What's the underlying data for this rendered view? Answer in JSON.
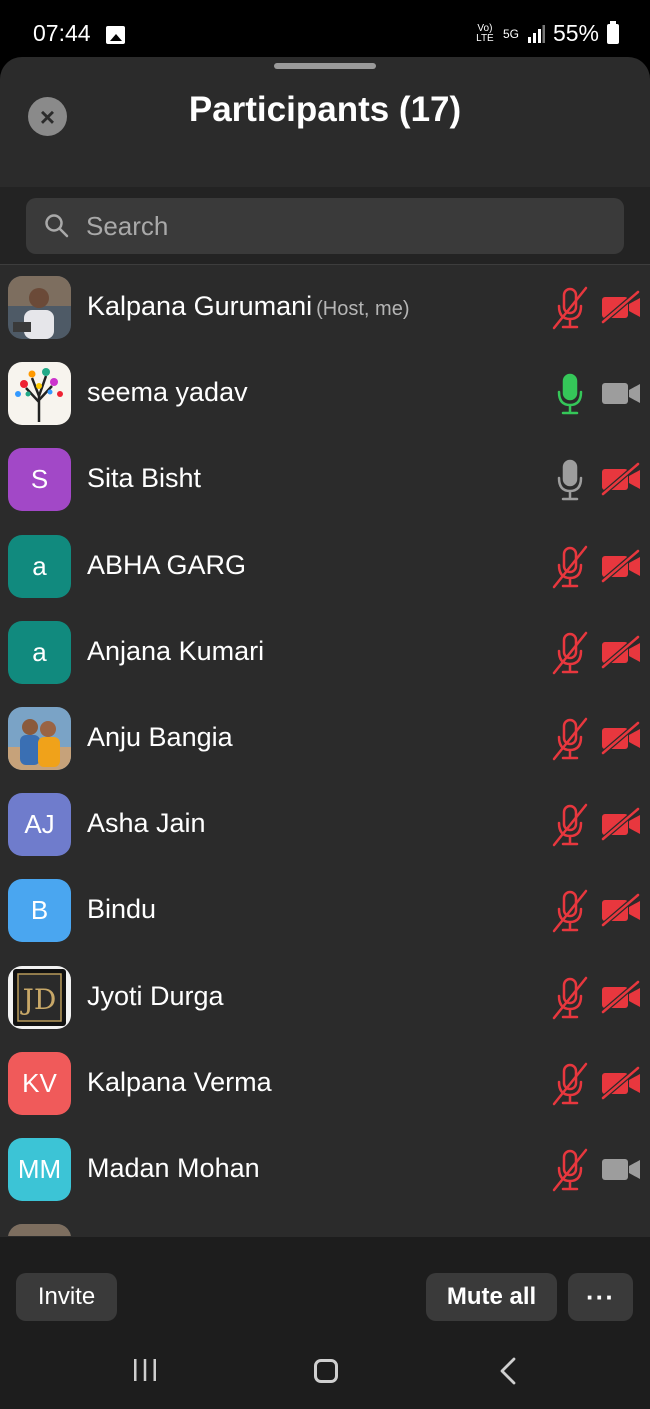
{
  "status_bar": {
    "time": "07:44",
    "network": "5G",
    "volte": "Vo) LTE",
    "battery": "55%"
  },
  "header": {
    "title": "Participants (17)",
    "close_icon": "close-icon"
  },
  "search": {
    "placeholder": "Search",
    "value": ""
  },
  "colors": {
    "muted_red": "#e8373e",
    "active_green": "#35c759",
    "neutral_gray": "#9d9d9d",
    "panel_bg": "#2b2b2b"
  },
  "participants": [
    {
      "name": "Kalpana Gurumani",
      "role": "(Host, me)",
      "avatar": {
        "type": "photo",
        "icon": "person-photo"
      },
      "mic": "muted",
      "video": "off"
    },
    {
      "name": "seema yadav",
      "role": "",
      "avatar": {
        "type": "photo",
        "icon": "tree-art-photo"
      },
      "mic": "active",
      "video": "on"
    },
    {
      "name": "Sita Bisht",
      "role": "",
      "avatar": {
        "type": "initials",
        "initials": "S",
        "color": "#a248c7"
      },
      "mic": "on",
      "video": "off"
    },
    {
      "name": "ABHA GARG",
      "role": "",
      "avatar": {
        "type": "initials",
        "initials": "a",
        "color": "#118a7e"
      },
      "mic": "muted",
      "video": "off"
    },
    {
      "name": "Anjana Kumari",
      "role": "",
      "avatar": {
        "type": "initials",
        "initials": "a",
        "color": "#118a7e"
      },
      "mic": "muted",
      "video": "off"
    },
    {
      "name": "Anju Bangia",
      "role": "",
      "avatar": {
        "type": "photo",
        "icon": "couple-photo"
      },
      "mic": "muted",
      "video": "off"
    },
    {
      "name": "Asha Jain",
      "role": "",
      "avatar": {
        "type": "initials",
        "initials": "AJ",
        "color": "#6f7ccc"
      },
      "mic": "muted",
      "video": "off"
    },
    {
      "name": "Bindu",
      "role": "",
      "avatar": {
        "type": "initials",
        "initials": "B",
        "color": "#4aa6f0"
      },
      "mic": "muted",
      "video": "off"
    },
    {
      "name": "Jyoti Durga",
      "role": "",
      "avatar": {
        "type": "photo",
        "icon": "jd-logo-photo"
      },
      "mic": "muted",
      "video": "off"
    },
    {
      "name": "Kalpana Verma",
      "role": "",
      "avatar": {
        "type": "initials",
        "initials": "KV",
        "color": "#f05a5a"
      },
      "mic": "muted",
      "video": "off"
    },
    {
      "name": "Madan Mohan",
      "role": "",
      "avatar": {
        "type": "initials",
        "initials": "MM",
        "color": "#3cc4d6"
      },
      "mic": "muted",
      "video": "on"
    },
    {
      "name": "",
      "role": "",
      "avatar": {
        "type": "photo",
        "icon": "person-photo"
      },
      "mic": "",
      "video": ""
    }
  ],
  "footer": {
    "invite_label": "Invite",
    "mute_all_label": "Mute all",
    "more_label": "···"
  },
  "nav": {
    "recent_icon": "recent-apps-icon",
    "home_icon": "home-icon",
    "back_icon": "back-icon"
  }
}
